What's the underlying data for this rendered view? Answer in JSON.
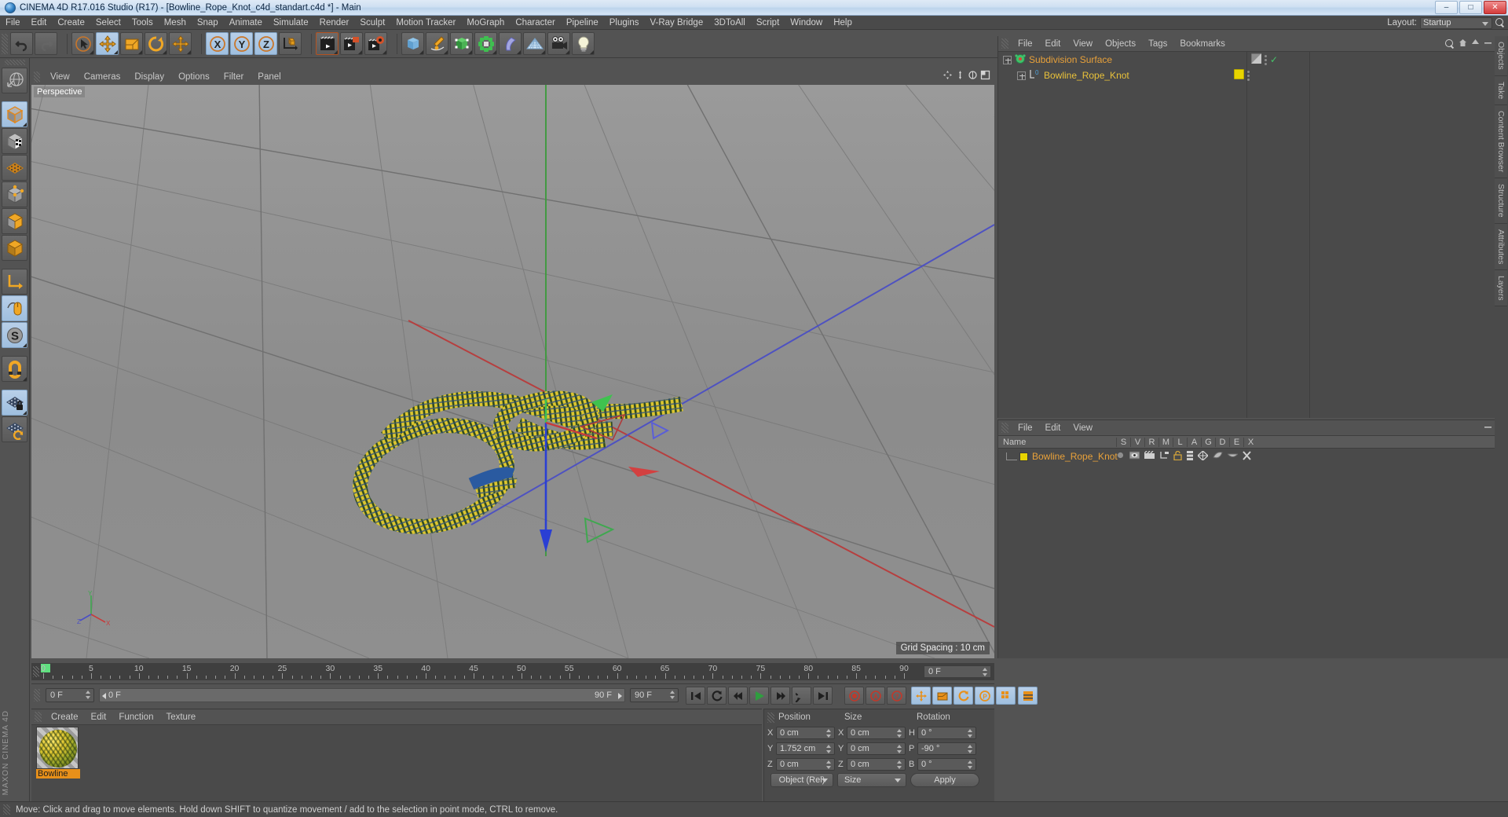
{
  "window": {
    "title": "CINEMA 4D R17.016 Studio (R17) - [Bowline_Rope_Knot_c4d_standart.c4d *] - Main",
    "app_icon": "cinema4d-logo-icon",
    "minimize": "–",
    "maximize": "□",
    "close": "✕"
  },
  "menubar": {
    "items": [
      "File",
      "Edit",
      "Create",
      "Select",
      "Tools",
      "Mesh",
      "Snap",
      "Animate",
      "Simulate",
      "Render",
      "Sculpt",
      "Motion Tracker",
      "MoGraph",
      "Character",
      "Pipeline",
      "Plugins",
      "V-Ray Bridge",
      "3DToAll",
      "Script",
      "Window",
      "Help"
    ],
    "layout_label": "Layout:",
    "layout_value": "Startup",
    "search_icon": "search-icon"
  },
  "toolbar": {
    "buttons": [
      {
        "name": "undo-button",
        "icon": "undo-arrow-icon",
        "active": false
      },
      {
        "name": "redo-button",
        "icon": "redo-arrow-icon",
        "active": false
      },
      {
        "name": "live-selection-button",
        "icon": "cursor-circle-icon",
        "active": false
      },
      {
        "name": "move-tool-button",
        "icon": "move-arrows-icon",
        "active": true
      },
      {
        "name": "scale-tool-button",
        "icon": "scale-box-icon",
        "active": false
      },
      {
        "name": "rotate-tool-button",
        "icon": "rotate-circle-icon",
        "active": false
      },
      {
        "name": "move-duplicate-button",
        "icon": "move-arrows-icon",
        "active": false
      },
      {
        "name": "lock-x-axis-button",
        "icon": "x-axis-icon",
        "active": true
      },
      {
        "name": "lock-y-axis-button",
        "icon": "y-axis-icon",
        "active": true
      },
      {
        "name": "lock-z-axis-button",
        "icon": "z-axis-icon",
        "active": true
      },
      {
        "name": "world-object-coordinates-button",
        "icon": "world-axis-cube-icon",
        "active": false
      },
      {
        "name": "render-view-button",
        "icon": "render-clapper-icon",
        "active": false
      },
      {
        "name": "render-region-button",
        "icon": "render-region-icon",
        "active": false
      },
      {
        "name": "render-queue-button",
        "icon": "render-settings-icon",
        "active": false
      },
      {
        "name": "add-cube-button",
        "icon": "blue-cube-icon",
        "active": false
      },
      {
        "name": "add-spline-button",
        "icon": "pen-spline-icon",
        "active": false
      },
      {
        "name": "add-generator-button",
        "icon": "green-cube-icon",
        "active": false
      },
      {
        "name": "add-array-button",
        "icon": "array-cluster-icon",
        "active": false
      },
      {
        "name": "add-deformer-button",
        "icon": "bend-deformer-icon",
        "active": false
      },
      {
        "name": "add-floor-button",
        "icon": "floor-grid-icon",
        "active": false
      },
      {
        "name": "add-camera-button",
        "icon": "camera-icon",
        "active": false
      },
      {
        "name": "add-light-button",
        "icon": "lightbulb-icon",
        "active": false
      }
    ]
  },
  "leftbar": {
    "buttons": [
      {
        "name": "undo-view-button",
        "icon": "globe-sphere-icon",
        "active": false
      },
      {
        "name": "model-mode-button",
        "icon": "model-cube-icon",
        "active": true
      },
      {
        "name": "texture-mode-button",
        "icon": "texture-checker-cube-icon",
        "active": false
      },
      {
        "name": "points-mode-button",
        "icon": "points-grid-icon",
        "active": false
      },
      {
        "name": "edges-mode-button",
        "icon": "edges-cube-icon",
        "active": false
      },
      {
        "name": "polygons-mode-button",
        "icon": "polygons-cube-icon",
        "active": false
      },
      {
        "name": "object-axis-mode-button",
        "icon": "axis-corner-icon",
        "active": false
      },
      {
        "name": "viewport-solo-button",
        "icon": "mouse-icon",
        "active": true
      },
      {
        "name": "enable-snapping-button",
        "icon": "snap-s-icon",
        "active": true
      },
      {
        "name": "magnet-tool-button",
        "icon": "magnet-icon",
        "active": false
      },
      {
        "name": "lock-workplane-button",
        "icon": "workplane-lock-icon",
        "active": true
      },
      {
        "name": "workplane-button",
        "icon": "workplane-rotate-icon",
        "active": false
      }
    ],
    "brand": "MAXON CINEMA 4D"
  },
  "viewport": {
    "menu": [
      "View",
      "Cameras",
      "Display",
      "Options",
      "Filter",
      "Panel"
    ],
    "label": "Perspective",
    "grid_spacing": "Grid Spacing : 10 cm",
    "axis_gizmo": {
      "x": "X",
      "y": "Y",
      "z": "Z"
    },
    "scene_object": "Bowline_Rope_Knot",
    "colors": {
      "x_axis": "#d64545",
      "y_axis": "#4fb04f",
      "z_axis": "#4f55d6",
      "background_top": "#979797",
      "background_bottom": "#7e7e7e",
      "rope_yellow": "#e8d43a",
      "rope_dark": "#2b4a2b",
      "rope_blue": "#2a5aa0"
    }
  },
  "object_manager": {
    "menu": [
      "File",
      "Edit",
      "View",
      "Objects",
      "Tags",
      "Bookmarks"
    ],
    "rows": [
      {
        "name": "Subdivision Surface",
        "icon": "subdivision-surface-icon",
        "indent": 0,
        "selected": true,
        "tag": "display-tag",
        "check": "✓"
      },
      {
        "name": "Bowline_Rope_Knot",
        "icon": "object-layer-icon",
        "indent": 1,
        "selected": false,
        "tag": "material-tag",
        "check": ""
      }
    ]
  },
  "attribute_manager": {
    "menu": [
      "File",
      "Edit",
      "View"
    ],
    "columns": [
      "Name",
      "S",
      "V",
      "R",
      "M",
      "L",
      "A",
      "G",
      "D",
      "E",
      "X"
    ],
    "row": {
      "name": "Bowline_Rope_Knot",
      "icons": [
        "dot-icon",
        "eye-icon",
        "clapper-icon",
        "hierarchy-icon",
        "unlock-icon",
        "layers-icon",
        "deformer-icon",
        "shading-icon",
        "cap-icon",
        "x-icon"
      ]
    }
  },
  "right_tabs": [
    "Objects",
    "Take",
    "Content Browser",
    "Structure",
    "Attributes",
    "Layers"
  ],
  "timeline": {
    "ticks": [
      "0",
      "5",
      "10",
      "15",
      "20",
      "25",
      "30",
      "35",
      "40",
      "45",
      "50",
      "55",
      "60",
      "65",
      "70",
      "75",
      "80",
      "85",
      "90"
    ],
    "current_frame_field": "0 F",
    "marker_color": "#5fe07f"
  },
  "playback": {
    "current_frame": "0 F",
    "range_start": "0 F",
    "range_end": "90 F",
    "end_frame": "90 F",
    "buttons": [
      {
        "name": "go-to-start-button",
        "icon": "skip-start-icon",
        "active": false
      },
      {
        "name": "loop-button",
        "icon": "loop-icon",
        "active": false
      },
      {
        "name": "step-back-button",
        "icon": "step-back-icon",
        "active": false
      },
      {
        "name": "play-button",
        "icon": "play-icon",
        "active": false
      },
      {
        "name": "step-forward-button",
        "icon": "step-forward-icon",
        "active": false
      },
      {
        "name": "play-forward-button",
        "icon": "play-forward-icon",
        "active": false
      },
      {
        "name": "go-to-end-button",
        "icon": "skip-end-icon",
        "active": false
      },
      {
        "name": "record-active-objects-button",
        "icon": "record-key-icon",
        "active": false
      },
      {
        "name": "autokeying-button",
        "icon": "autokey-icon",
        "active": false
      },
      {
        "name": "keyframe-selection-button",
        "icon": "keyframe-selection-icon",
        "active": false
      },
      {
        "name": "record-position-button",
        "icon": "position-key-icon",
        "active": true
      },
      {
        "name": "record-scale-button",
        "icon": "scale-key-icon",
        "active": true
      },
      {
        "name": "record-rotation-button",
        "icon": "rotation-key-icon",
        "active": true
      },
      {
        "name": "record-param-button",
        "icon": "param-key-icon",
        "active": true
      },
      {
        "name": "record-pla-button",
        "icon": "pla-key-icon",
        "active": true
      },
      {
        "name": "timeline-toggle-button",
        "icon": "timeline-icon",
        "active": true
      }
    ]
  },
  "material_manager": {
    "menu": [
      "Create",
      "Edit",
      "Function",
      "Texture"
    ],
    "materials": [
      {
        "name": "Bowline",
        "selected": true,
        "preview": "yellow-rope-sphere"
      }
    ]
  },
  "coordinate_manager": {
    "headers": [
      "Position",
      "Size",
      "Rotation"
    ],
    "position": {
      "x_label": "X",
      "x": "0 cm",
      "y_label": "Y",
      "y": "1.752 cm",
      "z_label": "Z",
      "z": "0 cm"
    },
    "size": {
      "x_label": "X",
      "x": "0 cm",
      "y_label": "Y",
      "y": "0 cm",
      "z_label": "Z",
      "z": "0 cm"
    },
    "rotation": {
      "h_label": "H",
      "h": "0 °",
      "p_label": "P",
      "p": "-90 °",
      "b_label": "B",
      "b": "0 °"
    },
    "mode_dropdown": "Object (Rel)",
    "size_dropdown": "Size",
    "apply_button": "Apply"
  },
  "statusbar": {
    "text": "Move: Click and drag to move elements. Hold down SHIFT to quantize movement / add to the selection in point mode, CTRL to remove."
  }
}
